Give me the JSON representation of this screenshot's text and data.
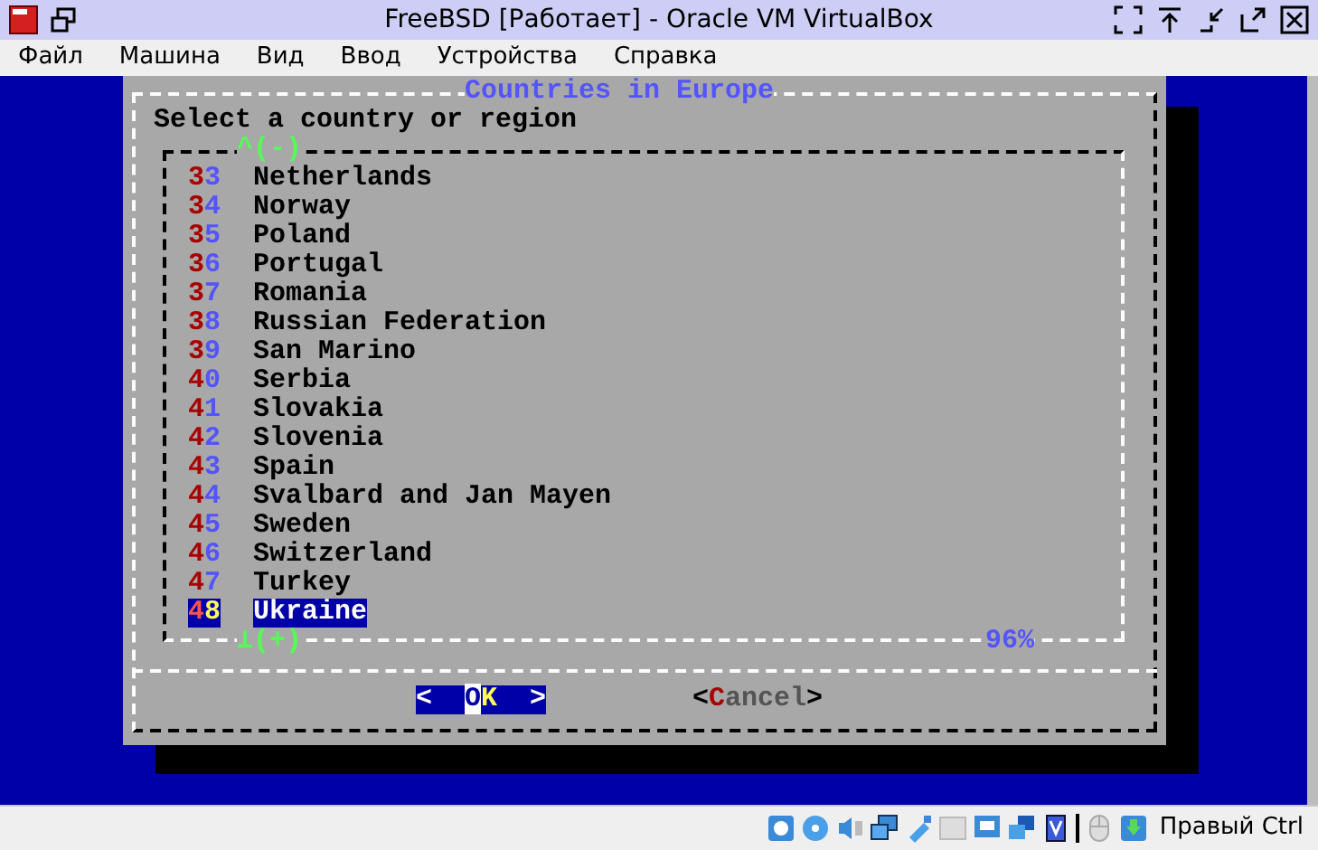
{
  "window": {
    "title": "FreeBSD [Работает] - Oracle VM VirtualBox"
  },
  "menu": [
    "Файл",
    "Машина",
    "Вид",
    "Ввод",
    "Устройства",
    "Справка"
  ],
  "dialog": {
    "title": "Countries in Europe",
    "prompt": "Select a country or region",
    "scroll_up": "^(-)",
    "scroll_down": "⊥(+)",
    "percent": "96%",
    "items": [
      {
        "tag": "33",
        "name": "Netherlands",
        "selected": false
      },
      {
        "tag": "34",
        "name": "Norway",
        "selected": false
      },
      {
        "tag": "35",
        "name": "Poland",
        "selected": false
      },
      {
        "tag": "36",
        "name": "Portugal",
        "selected": false
      },
      {
        "tag": "37",
        "name": "Romania",
        "selected": false
      },
      {
        "tag": "38",
        "name": "Russian Federation",
        "selected": false
      },
      {
        "tag": "39",
        "name": "San Marino",
        "selected": false
      },
      {
        "tag": "40",
        "name": "Serbia",
        "selected": false
      },
      {
        "tag": "41",
        "name": "Slovakia",
        "selected": false
      },
      {
        "tag": "42",
        "name": "Slovenia",
        "selected": false
      },
      {
        "tag": "43",
        "name": "Spain",
        "selected": false
      },
      {
        "tag": "44",
        "name": "Svalbard and Jan Mayen",
        "selected": false
      },
      {
        "tag": "45",
        "name": "Sweden",
        "selected": false
      },
      {
        "tag": "46",
        "name": "Switzerland",
        "selected": false
      },
      {
        "tag": "47",
        "name": "Turkey",
        "selected": false
      },
      {
        "tag": "48",
        "name": "Ukraine",
        "selected": true
      }
    ],
    "buttons": [
      {
        "open": "<",
        "hotkey": "O",
        "rest": "K",
        "close": ">",
        "selected": true
      },
      {
        "open": "<",
        "hotkey": "C",
        "rest": "ancel",
        "close": ">",
        "selected": false
      }
    ]
  },
  "status_bar": {
    "host_key": "Правый Ctrl"
  }
}
